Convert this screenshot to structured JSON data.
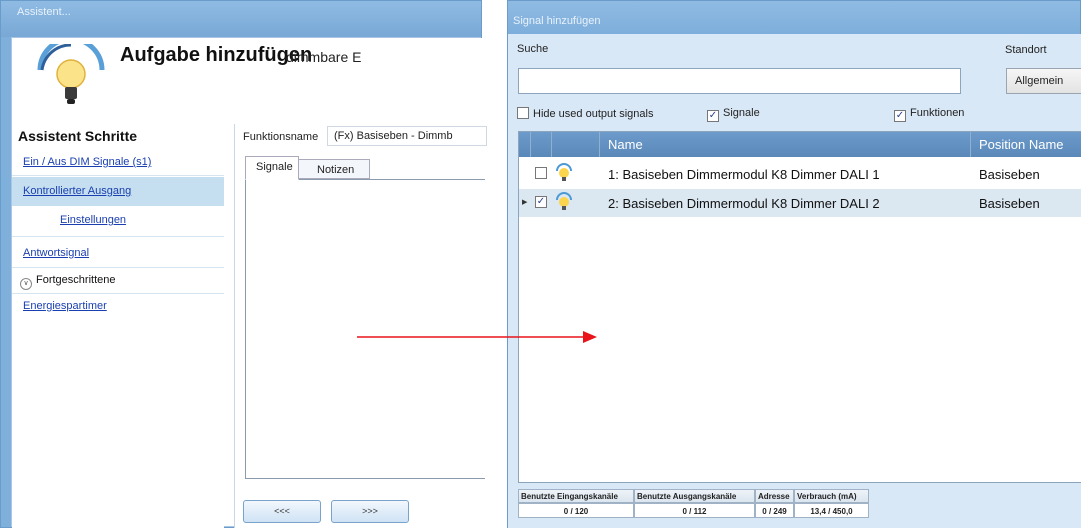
{
  "left_window": {
    "title": "Assistent...",
    "header_title": "Aufgabe hinzufügen",
    "header_subtitle": "dimmbare E",
    "steps_title": "Assistent Schritte",
    "steps": [
      {
        "label": "Ein / Aus DIM Signale (s1)"
      },
      {
        "label": "Kontrollierter Ausgang"
      },
      {
        "label": "Einstellungen"
      },
      {
        "label": "Antwortsignal"
      },
      {
        "label": "Fortgeschrittene"
      },
      {
        "label": "Energiespartimer"
      }
    ],
    "function_name_label": "Funktionsname",
    "function_name_value": "(Fx) Basiseben - Dimmb",
    "tabs": [
      {
        "label": "Signale"
      },
      {
        "label": "Notizen"
      }
    ],
    "prev_button": "<<<",
    "next_button": ">>>"
  },
  "right_window": {
    "title": "Signal hinzufügen",
    "search_label": "Suche",
    "search_value": "",
    "location_label": "Standort",
    "location_value": "Allgemein",
    "filters": [
      {
        "label": "Hide used output signals",
        "checked": false
      },
      {
        "label": "Signale",
        "checked": true
      },
      {
        "label": "Funktionen",
        "checked": true
      }
    ],
    "grid": {
      "columns": [
        "Name",
        "Position Name"
      ],
      "rows": [
        {
          "name": "1: Basiseben Dimmermodul K8 Dimmer DALI 1",
          "position": "Basiseben",
          "checked": false,
          "selected": false
        },
        {
          "name": "2: Basiseben Dimmermodul K8 Dimmer DALI 2",
          "position": "Basiseben",
          "checked": true,
          "selected": true
        }
      ]
    },
    "stats": [
      {
        "label": "Benutzte Eingangskanäle",
        "value": "0 / 120"
      },
      {
        "label": "Benutzte Ausgangskanäle",
        "value": "0 / 112"
      },
      {
        "label": "Adresse",
        "value": "0 / 249"
      },
      {
        "label": "Verbrauch (mA)",
        "value": "13,4 / 450,0"
      }
    ]
  },
  "colors": {
    "title_bar": "#7fb0dc",
    "grid_header": "#5f8ec0",
    "link": "#1a3fb0",
    "arrow": "#e8141a",
    "selected_step": "#c5dff0"
  }
}
